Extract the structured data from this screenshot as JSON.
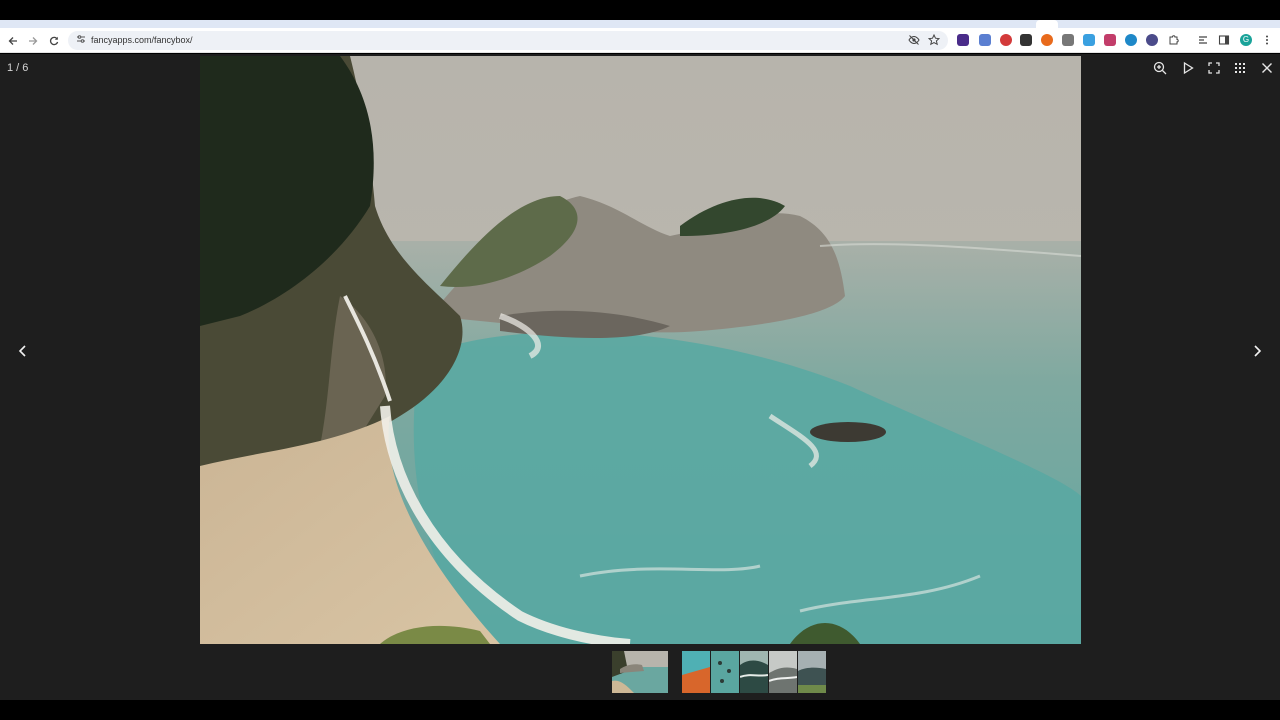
{
  "browser": {
    "url": "fancyapps.com/fancybox/",
    "icons": {
      "back": "arrow-left-icon",
      "forward": "arrow-right-icon",
      "reload": "reload-icon",
      "site_info": "tune-icon",
      "hide_eye": "eye-off-icon",
      "bookmark": "star-icon",
      "extensions": "puzzle-icon",
      "menu": "kebab-menu-icon"
    },
    "profile_initial": "G"
  },
  "viewer": {
    "counter": "1 / 6",
    "controls": [
      "zoom-in-icon",
      "play-icon",
      "fullscreen-icon",
      "grid-icon",
      "close-icon"
    ],
    "nav": {
      "prev": "chevron-left-icon",
      "next": "chevron-right-icon"
    },
    "image_subject": "coastal cove with waterfall, rocky headland and turquoise water",
    "thumbnails_count": 6,
    "active_thumbnail": 1
  },
  "colors": {
    "viewer_bg": "#1e1e1e",
    "toolbar_bg": "#ffffff",
    "omnibox_bg": "#eef1f6",
    "profile": "#1aa39a"
  }
}
